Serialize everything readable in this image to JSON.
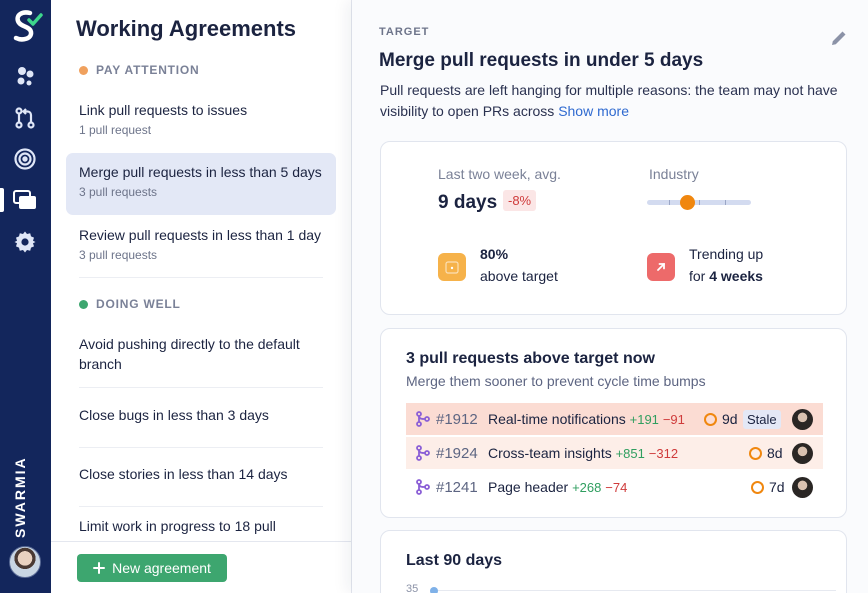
{
  "brand": "SWARMIA",
  "list": {
    "title": "Working Agreements",
    "sections": [
      {
        "label": "PAY ATTENTION",
        "color": "#f0a15e"
      },
      {
        "label": "DOING WELL",
        "color": "#3da66f"
      }
    ],
    "items": [
      {
        "title": "Link pull requests to issues",
        "sub": "1 pull request"
      },
      {
        "title": "Merge pull requests in less than 5 days",
        "sub": "3 pull requests"
      },
      {
        "title": "Review pull requests in less than 1 day",
        "sub": "3 pull requests"
      },
      {
        "title": "Avoid pushing directly to the default branch"
      },
      {
        "title": "Close bugs in less than 3 days"
      },
      {
        "title": "Close stories in less than 14 days"
      },
      {
        "title": "Limit work in progress to 18 pull"
      }
    ],
    "new_button": "New agreement"
  },
  "detail": {
    "kicker": "TARGET",
    "title": "Merge pull requests in under 5 days",
    "desc": "Pull requests are left hanging for multiple reasons: the team may not have visibility to open PRs across",
    "show_more": "Show more",
    "summary": {
      "avg_label": "Last two week, avg.",
      "avg_value": "9 days",
      "avg_delta": "-8%",
      "industry_label": "Industry",
      "above_pct": "80%",
      "above_text": "above target",
      "trend_line1": "Trending up",
      "trend_for": "for",
      "trend_weeks": "4 weeks"
    },
    "prs_card": {
      "title": "3 pull requests above target now",
      "subtitle": "Merge them sooner to prevent cycle time bumps",
      "rows": [
        {
          "num": "#1912",
          "name": "Real-time notifications",
          "plus": "+191",
          "minus": "−91",
          "age": "9d",
          "badge": "Stale"
        },
        {
          "num": "#1924",
          "name": "Cross-team insights",
          "plus": "+851",
          "minus": "−312",
          "age": "8d"
        },
        {
          "num": "#1241",
          "name": "Page header",
          "plus": "+268",
          "minus": "−74",
          "age": "7d"
        }
      ]
    },
    "history": {
      "title": "Last 90 days",
      "y_tick": "35"
    }
  }
}
